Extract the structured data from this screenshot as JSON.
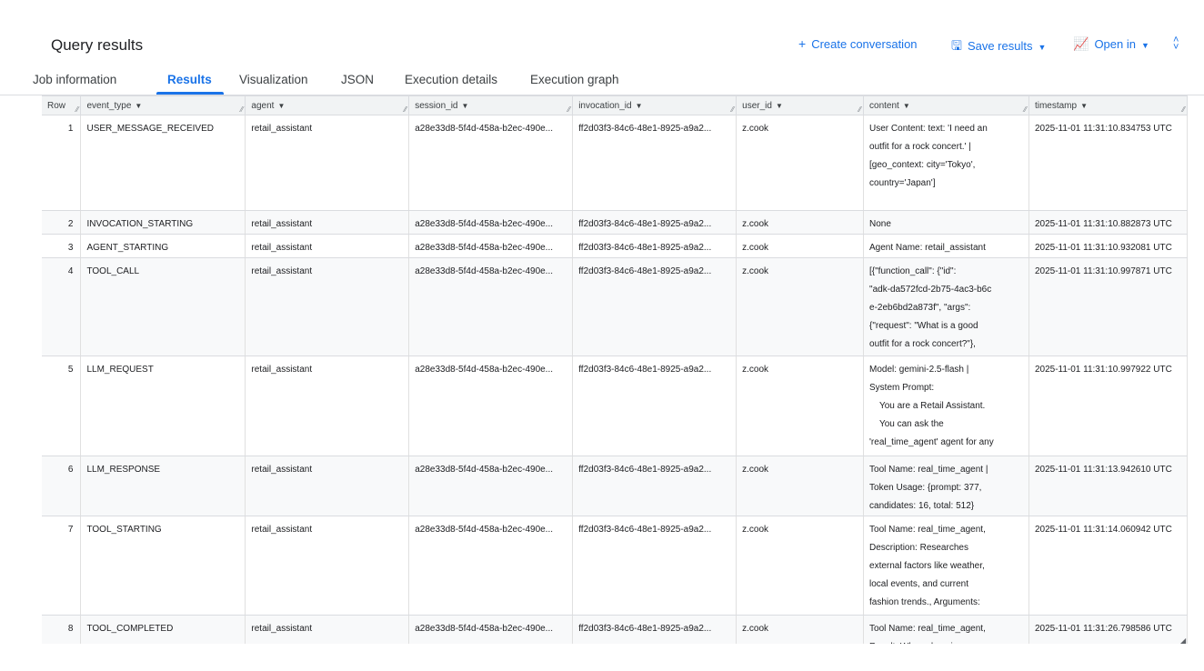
{
  "header": {
    "title": "Query results",
    "create_conversation": "Create conversation",
    "save_results": "Save results",
    "open_in": "Open in"
  },
  "tabs": [
    "Job information",
    "Results",
    "Visualization",
    "JSON",
    "Execution details",
    "Execution graph"
  ],
  "active_tab": "Results",
  "columns": [
    "Row",
    "event_type",
    "agent",
    "session_id",
    "invocation_id",
    "user_id",
    "content",
    "timestamp"
  ],
  "rows": [
    {
      "row": "1",
      "event_type": "USER_MESSAGE_RECEIVED",
      "agent": "retail_assistant",
      "session_id": "a28e33d8-5f4d-458a-b2ec-490e...",
      "invocation_id": "ff2d03f3-84c6-48e1-8925-a9a2...",
      "user_id": "z.cook",
      "content": [
        "User Content: text: 'I need an",
        "outfit for a rock concert.' |",
        "[geo_context: city='Tokyo',",
        "country='Japan']"
      ],
      "timestamp": "2025-11-01 11:31:10.834753 UTC"
    },
    {
      "row": "2",
      "event_type": "INVOCATION_STARTING",
      "agent": "retail_assistant",
      "session_id": "a28e33d8-5f4d-458a-b2ec-490e...",
      "invocation_id": "ff2d03f3-84c6-48e1-8925-a9a2...",
      "user_id": "z.cook",
      "content": [
        "None"
      ],
      "timestamp": "2025-11-01 11:31:10.882873 UTC"
    },
    {
      "row": "3",
      "event_type": "AGENT_STARTING",
      "agent": "retail_assistant",
      "session_id": "a28e33d8-5f4d-458a-b2ec-490e...",
      "invocation_id": "ff2d03f3-84c6-48e1-8925-a9a2...",
      "user_id": "z.cook",
      "content": [
        "Agent Name: retail_assistant"
      ],
      "timestamp": "2025-11-01 11:31:10.932081 UTC"
    },
    {
      "row": "4",
      "event_type": "TOOL_CALL",
      "agent": "retail_assistant",
      "session_id": "a28e33d8-5f4d-458a-b2ec-490e...",
      "invocation_id": "ff2d03f3-84c6-48e1-8925-a9a2...",
      "user_id": "z.cook",
      "content": [
        "[{\"function_call\": {\"id\":",
        "\"adk-da572fcd-2b75-4ac3-b6c",
        "e-2eb6bd2a873f\", \"args\":",
        "{\"request\": \"What is a good",
        "outfit for a rock concert?\"},"
      ],
      "timestamp": "2025-11-01 11:31:10.997871 UTC"
    },
    {
      "row": "5",
      "event_type": "LLM_REQUEST",
      "agent": "retail_assistant",
      "session_id": "a28e33d8-5f4d-458a-b2ec-490e...",
      "invocation_id": "ff2d03f3-84c6-48e1-8925-a9a2...",
      "user_id": "z.cook",
      "content": [
        "Model: gemini-2.5-flash |",
        "System Prompt:",
        "    You are a Retail Assistant.",
        "    You can ask the",
        "'real_time_agent' agent for any"
      ],
      "timestamp": "2025-11-01 11:31:10.997922 UTC"
    },
    {
      "row": "6",
      "event_type": "LLM_RESPONSE",
      "agent": "retail_assistant",
      "session_id": "a28e33d8-5f4d-458a-b2ec-490e...",
      "invocation_id": "ff2d03f3-84c6-48e1-8925-a9a2...",
      "user_id": "z.cook",
      "content": [
        "Tool Name: real_time_agent |",
        "Token Usage: {prompt: 377,",
        "candidates: 16, total: 512}"
      ],
      "timestamp": "2025-11-01 11:31:13.942610 UTC"
    },
    {
      "row": "7",
      "event_type": "TOOL_STARTING",
      "agent": "retail_assistant",
      "session_id": "a28e33d8-5f4d-458a-b2ec-490e...",
      "invocation_id": "ff2d03f3-84c6-48e1-8925-a9a2...",
      "user_id": "z.cook",
      "content": [
        "Tool Name: real_time_agent,",
        "Description: Researches",
        "external factors like weather,",
        "local events, and current",
        "fashion trends., Arguments:"
      ],
      "timestamp": "2025-11-01 11:31:14.060942 UTC"
    },
    {
      "row": "8",
      "event_type": "TOOL_COMPLETED",
      "agent": "retail_assistant",
      "session_id": "a28e33d8-5f4d-458a-b2ec-490e...",
      "invocation_id": "ff2d03f3-84c6-48e1-8925-a9a2...",
      "user_id": "z.cook",
      "content": [
        "Tool Name: real_time_agent,",
        "Result: When choosing an"
      ],
      "timestamp": "2025-11-01 11:31:26.798586 UTC"
    }
  ],
  "colors": {
    "accent": "#1a73e8",
    "header_bg": "#f1f3f4",
    "alt_row": "#f8f9fa"
  }
}
